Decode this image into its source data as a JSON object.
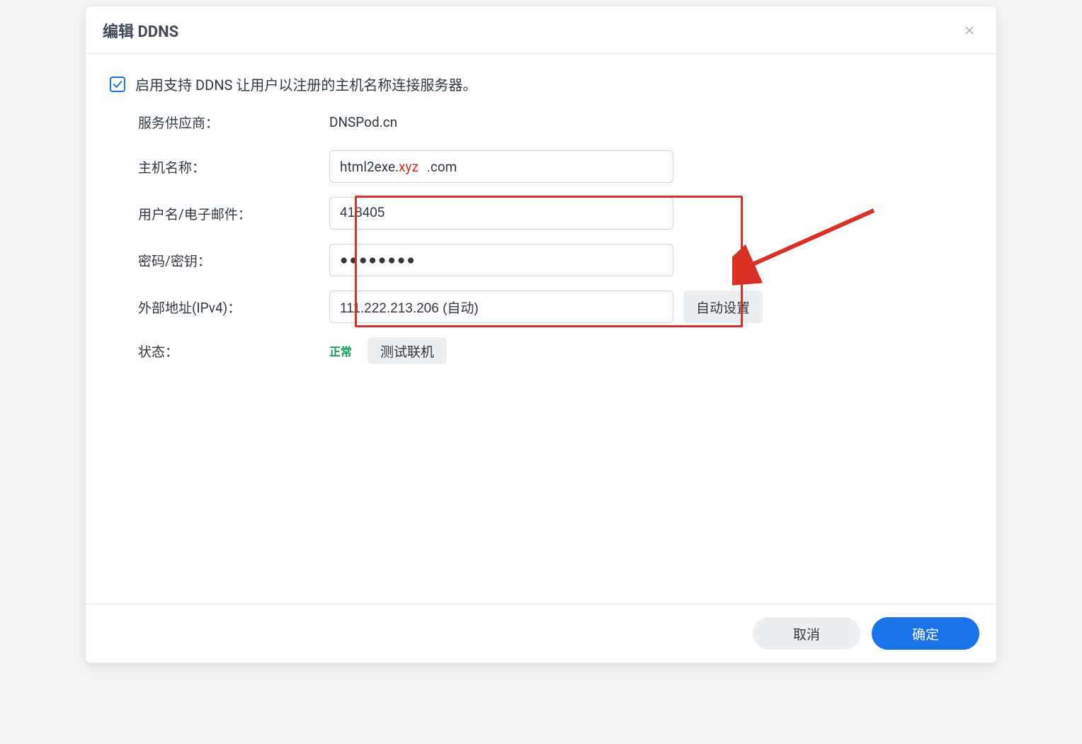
{
  "dialog": {
    "title": "编辑 DDNS",
    "enable_label": "启用支持 DDNS 让用户以注册的主机名称连接服务器。",
    "enable_checked": true,
    "labels": {
      "provider": "服务供应商：",
      "hostname": "主机名称：",
      "username": "用户名/电子邮件：",
      "password": "密码/密钥：",
      "external_ipv4": "外部地址(IPv4)：",
      "status": "状态："
    },
    "values": {
      "provider": "DNSPod.cn",
      "hostname_prefix": "html2exe.",
      "hostname_censored": "xyz",
      "hostname_blurred": " ",
      "hostname_suffix": ".com",
      "username": "418405",
      "password_mask": "●●●●●●●●",
      "external_ipv4": "111.222.213.206 (自动)",
      "status": "正常"
    },
    "buttons": {
      "auto_set": "自动设置",
      "test_connection": "测试联机",
      "cancel": "取消",
      "ok": "确定"
    },
    "colors": {
      "accent": "#1a73e8",
      "highlight": "#d93025",
      "status_green": "#0f9d58"
    }
  }
}
